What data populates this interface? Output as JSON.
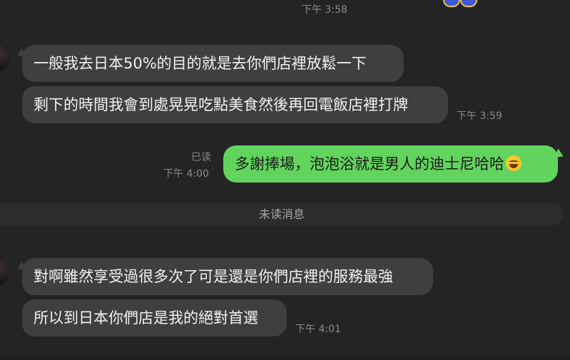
{
  "chat": {
    "top_timestamp": "下午 3:58",
    "group1": {
      "messages": [
        "一般我去日本50%的目的就是去你們店裡放鬆一下",
        "剩下的時間我會到處晃晃吃點美食然後再回電飯店裡打牌"
      ],
      "timestamp": "下午 3:59"
    },
    "outgoing": {
      "text": "多謝捧場，泡泡浴就是男人的迪士尼哈哈",
      "emoji": "grinning-face-emoji",
      "read_status": "已读",
      "timestamp": "下午 4:00"
    },
    "unread_divider": "未读消息",
    "group2": {
      "messages": [
        "對啊雖然享受過很多次了可是還是你們店裡的服務最強",
        "所以到日本你們店是我的絕對首選"
      ],
      "timestamp": "下午 4:01"
    }
  },
  "colors": {
    "background": "#242424",
    "incoming_bubble": "#3f3f41",
    "outgoing_bubble": "#62d45e",
    "timestamp_text": "#8b8b8b"
  }
}
